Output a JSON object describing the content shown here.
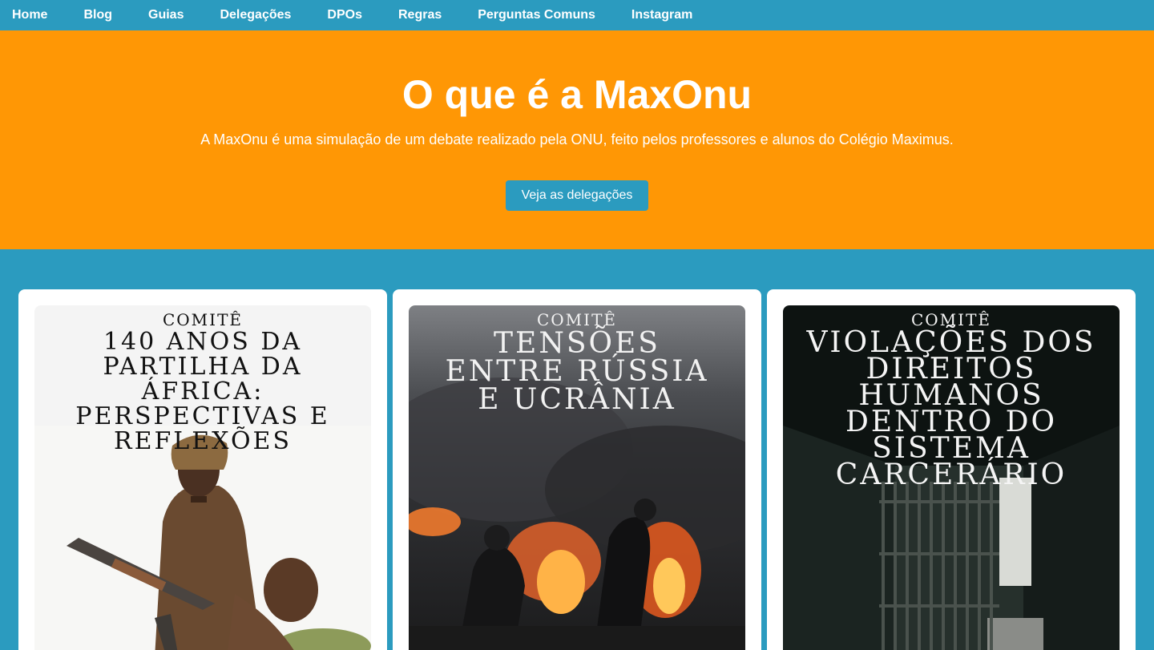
{
  "nav": [
    "Home",
    "Blog",
    "Guias",
    "Delegações",
    "DPOs",
    "Regras",
    "Perguntas Comuns",
    "Instagram"
  ],
  "hero": {
    "title": "O que é a MaxOnu",
    "subtitle": "A MaxOnu é uma simulação de um debate realizado pela ONU, feito pelos professores e alunos do Colégio Maximus.",
    "button": "Veja as delegações"
  },
  "cards": [
    {
      "label": "COMITÊ",
      "title": "140 ANOS DA PARTILHA DA ÁFRICA: PERSPECTIVAS E REFLEXÕES"
    },
    {
      "label": "COMITÊ",
      "title": "TENSÕES ENTRE RÚSSIA E UCRÂNIA"
    },
    {
      "label": "COMITÊ",
      "title": "VIOLAÇÕES DOS DIREITOS HUMANOS DENTRO DO SISTEMA CARCERÁRIO"
    }
  ],
  "colors": {
    "nav_bg": "#2b9bbf",
    "hero_bg": "#ff9705",
    "button_bg": "#2b9bbf",
    "card_bg": "#ffffff"
  }
}
